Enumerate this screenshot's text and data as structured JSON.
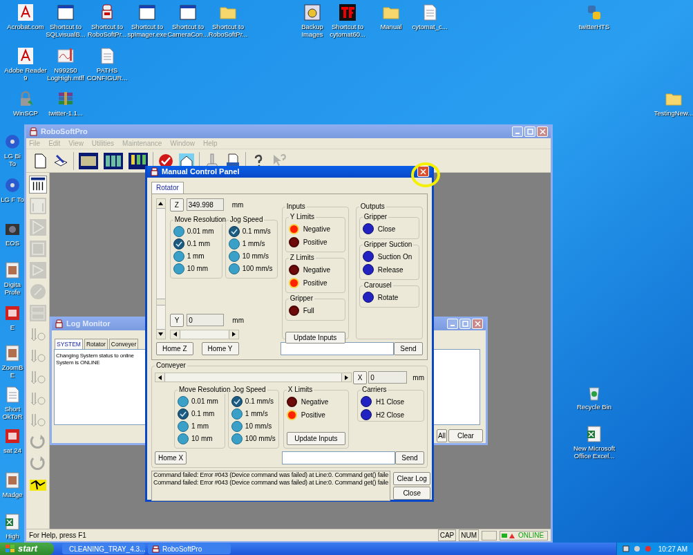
{
  "desktop": {
    "icons": [
      {
        "label": "Acrobat.com"
      },
      {
        "label": "Shortcut to SQLvisualB..."
      },
      {
        "label": "Shortcut to RoboSoftPr..."
      },
      {
        "label": "Shortcut to spImager.exe"
      },
      {
        "label": "Shortcut to CameraCon..."
      },
      {
        "label": "Shortcut to RoboSoftPr..."
      },
      {
        "label": "Backup Images"
      },
      {
        "label": "Shortcut to cytomat60..."
      },
      {
        "label": "Manual"
      },
      {
        "label": "cytomat_c..."
      },
      {
        "label": "twitterHTS"
      },
      {
        "label": "Adobe Reader 9"
      },
      {
        "label": "N99250 LogHigh.mtff"
      },
      {
        "label": "PATHS CONFIGUR..."
      },
      {
        "label": "WinSCP"
      },
      {
        "label": "twitter-1.1..."
      },
      {
        "label": "TestingNew..."
      },
      {
        "label": "LG Bi To"
      },
      {
        "label": "LG F To"
      },
      {
        "label": "EOS"
      },
      {
        "label": "Digita Profe"
      },
      {
        "label": "E"
      },
      {
        "label": "ZoomB E"
      },
      {
        "label": "Short OkToR"
      },
      {
        "label": "sat 24"
      },
      {
        "label": "Madge"
      },
      {
        "label": "High"
      },
      {
        "label": "Recycle Bin"
      },
      {
        "label": "New Microsoft Office Excel..."
      }
    ]
  },
  "main_window": {
    "title": "RoboSoftPro",
    "menu": [
      {
        "label": "File",
        "disabled": true
      },
      {
        "label": "Edit",
        "disabled": true
      },
      {
        "label": "View",
        "disabled": true
      },
      {
        "label": "Utilities",
        "disabled": true
      },
      {
        "label": "Maintenance",
        "disabled": true
      },
      {
        "label": "Window",
        "disabled": true
      },
      {
        "label": "Help",
        "disabled": true
      }
    ],
    "status_bar": {
      "help": "For Help, press F1",
      "indicators": [
        "CAP",
        "NUM"
      ],
      "status": "ONLINE"
    }
  },
  "log_monitor": {
    "title": "Log Monitor",
    "tabs": [
      {
        "label": "SYSTEM",
        "selected": true
      },
      {
        "label": "Rotator",
        "selected": false
      },
      {
        "label": "Conveyer",
        "selected": false
      }
    ],
    "lines": [
      "Changing System status to online",
      "System is ONLINE"
    ],
    "buttons": [
      "All",
      "Clear"
    ]
  },
  "manual_control_panel": {
    "title": "Manual Control Panel",
    "tabs": [
      {
        "label": "Rotator",
        "selected": true
      }
    ],
    "rotator": {
      "z_axis": {
        "label": "Z",
        "value": "349.998",
        "unit": "mm"
      },
      "y_axis": {
        "label": "Y",
        "value": "0",
        "unit": "mm"
      },
      "move_resolution": {
        "title": "Move Resolution",
        "options": [
          {
            "label": "0.01 mm",
            "selected": false
          },
          {
            "label": "0.1 mm",
            "selected": true
          },
          {
            "label": "1 mm",
            "selected": false
          },
          {
            "label": "10 mm",
            "selected": false
          }
        ]
      },
      "jog_speed": {
        "title": "Jog Speed",
        "options": [
          {
            "label": "0.1 mm/s",
            "selected": true
          },
          {
            "label": "1 mm/s",
            "selected": false
          },
          {
            "label": "10 mm/s",
            "selected": false
          },
          {
            "label": "100 mm/s",
            "selected": false
          }
        ]
      },
      "inputs": {
        "title": "Inputs",
        "groups": [
          {
            "title": "Y Limits",
            "leds": [
              {
                "label": "Negative",
                "on": true
              },
              {
                "label": "Positive",
                "on": false
              }
            ]
          },
          {
            "title": "Z Limits",
            "leds": [
              {
                "label": "Negative",
                "on": false
              },
              {
                "label": "Positive",
                "on": true
              }
            ]
          },
          {
            "title": "Gripper",
            "leds": [
              {
                "label": "Full",
                "on": false
              }
            ]
          }
        ],
        "button": "Update Inputs"
      },
      "outputs": {
        "title": "Outputs",
        "groups": [
          {
            "title": "Gripper",
            "items": [
              "Close"
            ]
          },
          {
            "title": "Gripper Suction",
            "items": [
              "Suction On",
              "Release"
            ]
          },
          {
            "title": "Carousel",
            "items": [
              "Rotate"
            ]
          }
        ]
      },
      "home_buttons": [
        "Home Z",
        "Home Y"
      ],
      "send_button": "Send"
    },
    "conveyer": {
      "title": "Conveyer",
      "x_axis": {
        "label": "X",
        "value": "0",
        "unit": "mm"
      },
      "move_resolution": {
        "title": "Move Resolution",
        "options": [
          {
            "label": "0.01 mm",
            "selected": false
          },
          {
            "label": "0.1 mm",
            "selected": true
          },
          {
            "label": "1 mm",
            "selected": false
          },
          {
            "label": "10 mm",
            "selected": false
          }
        ]
      },
      "jog_speed": {
        "title": "Jog Speed",
        "options": [
          {
            "label": "0.1 mm/s",
            "selected": true
          },
          {
            "label": "1 mm/s",
            "selected": false
          },
          {
            "label": "10 mm/s",
            "selected": false
          },
          {
            "label": "100 mm/s",
            "selected": false
          }
        ]
      },
      "x_limits": {
        "title": "X Limits",
        "leds": [
          {
            "label": "Negative",
            "on": false
          },
          {
            "label": "Positive",
            "on": true
          }
        ],
        "button": "Update Inputs"
      },
      "carriers": {
        "title": "Carriers",
        "items": [
          "H1 Close",
          "H2 Close"
        ]
      },
      "home_button": "Home X",
      "send_button": "Send"
    },
    "log": [
      "Command failed: Error #043 (Device command was failed) at Line:0. Command get() faile",
      "Command failed: Error #043 (Device command was failed) at Line:0. Command get() faile"
    ],
    "buttons": [
      "Clear Log",
      "Close"
    ]
  },
  "taskbar": {
    "start": "start",
    "tasks": [
      {
        "label": "CLEANING_TRAY_4.3...",
        "selected": false
      },
      {
        "label": "RoboSoftPro",
        "selected": false
      }
    ],
    "clock": "10:27 AM"
  }
}
